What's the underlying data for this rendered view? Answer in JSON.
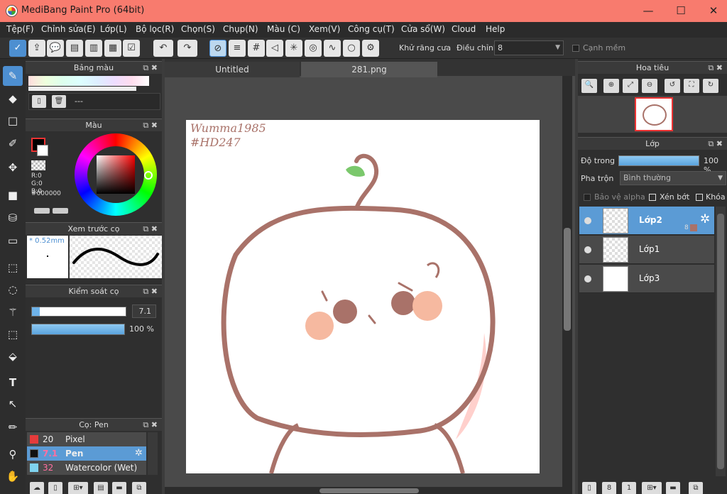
{
  "window": {
    "title": "MediBang Paint Pro (64bit)",
    "minimize": "—",
    "maximize": "☐",
    "close": "✕"
  },
  "menu": [
    "Tệp(F)",
    "Chỉnh sửa(E)",
    "Lớp(L)",
    "Bộ lọc(R)",
    "Chọn(S)",
    "Chụp(N)",
    "Màu (C)",
    "Xem(V)",
    "Công cụ(T)",
    "Cửa sổ(W)",
    "Cloud",
    "Help"
  ],
  "toolbar": {
    "antialias_label": "Khử răng cưa",
    "adjust_label": "Điều chỉnh",
    "adjust_value": "8",
    "soft_edge_label": "Cạnh mềm"
  },
  "palette_panel": {
    "title": "Bảng màu",
    "swatch_name": "---"
  },
  "color_panel": {
    "title": "Màu",
    "r": "R:0",
    "g": "G:0",
    "b": "B:0",
    "hex": "#000000"
  },
  "preview_panel": {
    "title": "Xem trước cọ",
    "size": "* 0.52mm"
  },
  "brush_control": {
    "title": "Kiểm soát cọ",
    "size_value": "7.1",
    "opacity_value": "100 %",
    "size_level": 0.08,
    "opacity_level": 1.0
  },
  "brush_list": {
    "title": "Cọ: Pen",
    "items": [
      {
        "size": "20",
        "name": "Pixel",
        "color": "#e53b3b"
      },
      {
        "size": "7.1",
        "name": "Pen",
        "color": "#111111"
      },
      {
        "size": "32",
        "name": "Watercolor (Wet)",
        "color": "#7fd3ef"
      }
    ]
  },
  "document_tabs": [
    "Untitled",
    "281.png"
  ],
  "canvas": {
    "signature": "Wumma1985 #HD247"
  },
  "navigator": {
    "title": "Hoa tiêu"
  },
  "layer_panel": {
    "title": "Lớp",
    "opacity_label": "Độ trong",
    "opacity_value": "100 %",
    "blend_label": "Pha trộn",
    "blend_value": "Bình thường",
    "protect_alpha": "Bảo vệ alpha",
    "clipping": "Xén bớt",
    "lock": "Khóa",
    "layers": [
      {
        "name": "Lớp2",
        "badge": "8"
      },
      {
        "name": "Lớp1"
      },
      {
        "name": "Lớp3"
      }
    ]
  },
  "colors": {
    "titlebar": "#f87b6e",
    "accent": "#4d8fd1",
    "stroke": "#b07a70"
  }
}
